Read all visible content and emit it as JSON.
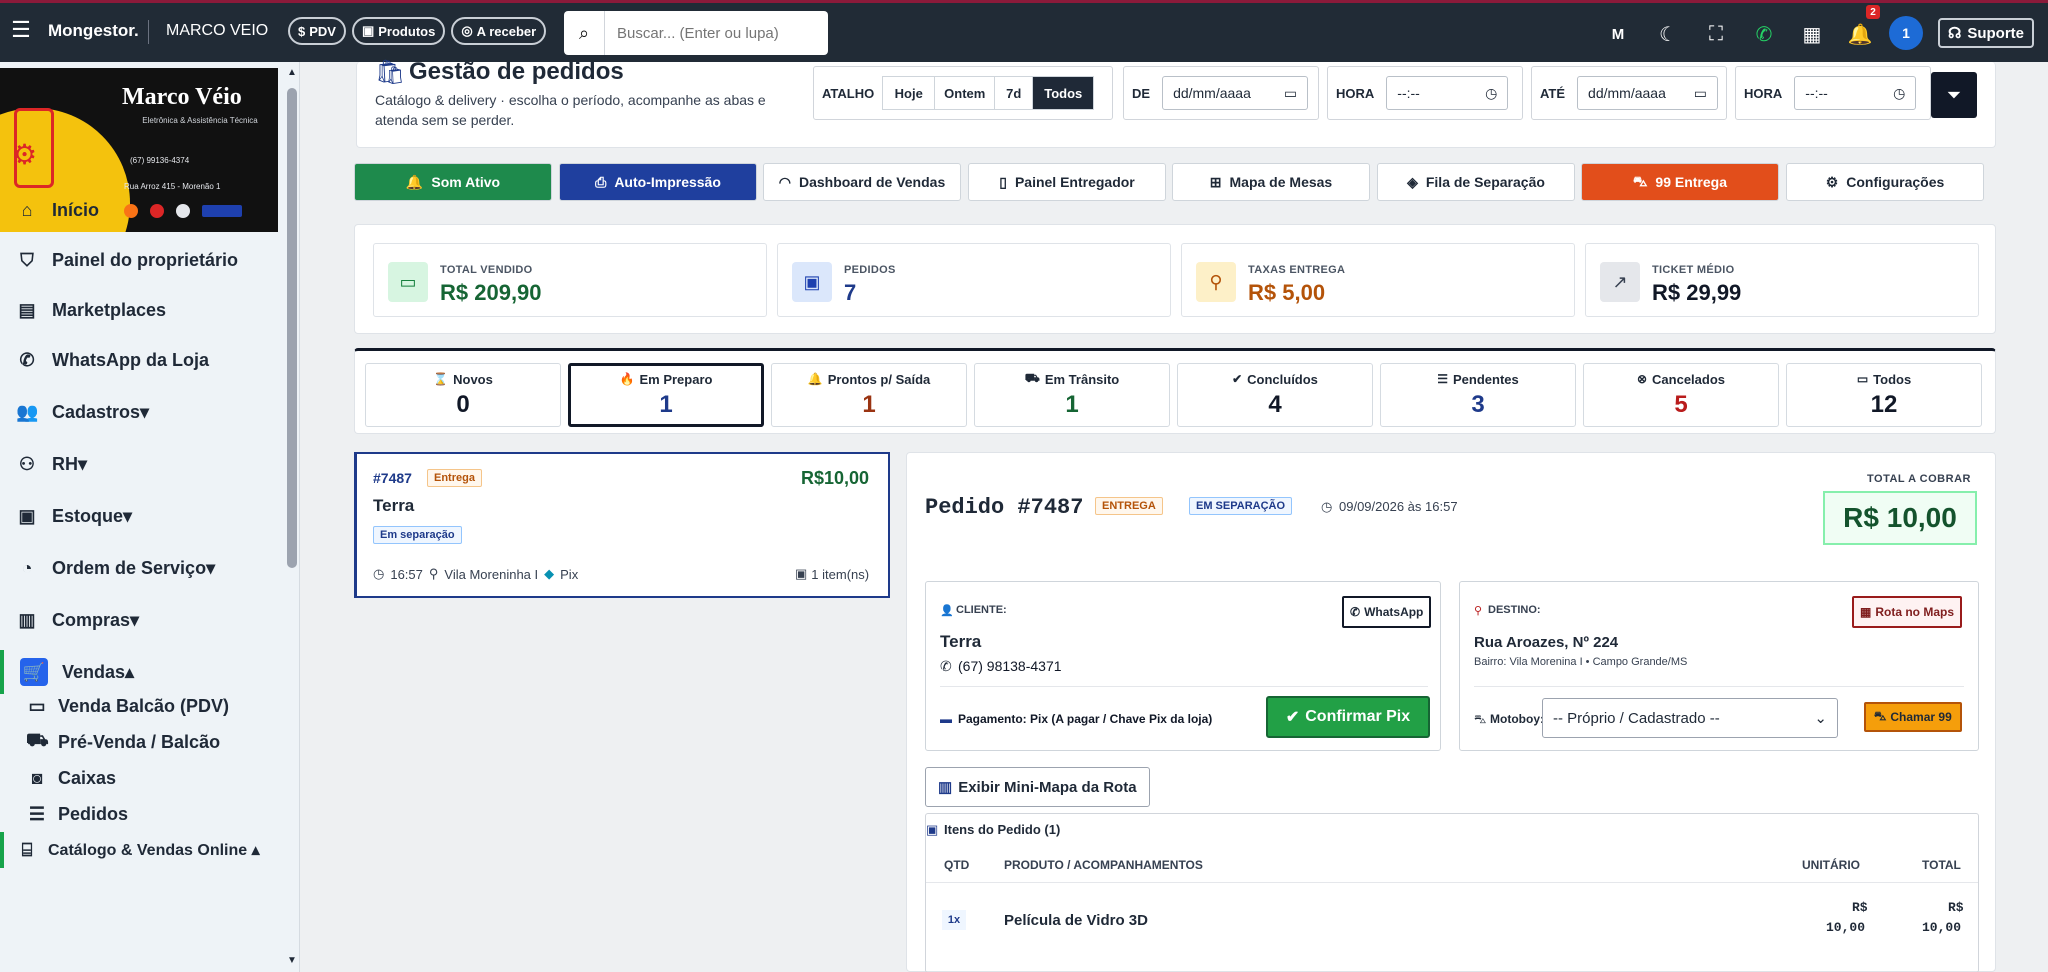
{
  "topbar": {
    "brand": "Mongestor.",
    "store": "MARCO VEIO",
    "pills": [
      {
        "icon": "dollar-icon",
        "label": "PDV"
      },
      {
        "icon": "box-icon",
        "label": "Produtos"
      },
      {
        "icon": "money-icon",
        "label": "A receber"
      }
    ],
    "search_placeholder": "Buscar... (Enter ou lupa)",
    "notif_count": "2",
    "avatar": "1",
    "support": "Suporte"
  },
  "logo": {
    "name": "Marco Véio",
    "subtitle": "Eletrônica & Assistência Técnica",
    "phone": "(67) 99136-4374",
    "address": "Rua Arroz 415 - Morenão 1"
  },
  "sidebar": {
    "items": [
      {
        "icon": "home-icon",
        "glyph": "⌂",
        "label": "Início"
      },
      {
        "icon": "shield-icon",
        "glyph": "⛉",
        "label": "Painel do proprietário"
      },
      {
        "icon": "store-icon",
        "glyph": "▤",
        "label": "Marketplaces"
      },
      {
        "icon": "whatsapp-icon",
        "glyph": "✆",
        "label": "WhatsApp da Loja"
      },
      {
        "icon": "users-icon",
        "glyph": "👥",
        "label": "Cadastros▾"
      },
      {
        "icon": "people-icon",
        "glyph": "⚇",
        "label": "RH▾"
      },
      {
        "icon": "box-icon",
        "glyph": "▣",
        "label": "Estoque▾"
      },
      {
        "icon": "gauge-icon",
        "glyph": "◔",
        "label": "Ordem de Serviço▾"
      },
      {
        "icon": "bag-icon",
        "glyph": "▥",
        "label": "Compras▾"
      },
      {
        "icon": "cart-icon",
        "glyph": "🛒",
        "label": "Vendas▴"
      }
    ],
    "subitems": [
      {
        "icon": "register-icon",
        "glyph": "▭",
        "label": "Venda Balcão (PDV)"
      },
      {
        "icon": "cart-small-icon",
        "glyph": "⛟",
        "label": "Pré-Venda / Balcão"
      },
      {
        "icon": "cash-icon",
        "glyph": "◙",
        "label": "Caixas"
      },
      {
        "icon": "list-icon",
        "glyph": "☰",
        "label": "Pedidos"
      },
      {
        "icon": "shop-icon",
        "glyph": "⌸",
        "label": "Catálogo & Vendas Online ▴"
      }
    ]
  },
  "header": {
    "title": "Gestão de pedidos",
    "subtitle": "Catálogo & delivery · escolha o período, acompanhe as abas e atenda sem se perder.",
    "atalho_label": "ATALHO",
    "atalhos": [
      "Hoje",
      "Ontem",
      "7d",
      "Todos"
    ],
    "de_label": "DE",
    "ate_label": "ATÉ",
    "hora_label": "HORA",
    "date_placeholder": "dd/mm/aaaa",
    "time_placeholder": "--:--"
  },
  "quick_buttons": [
    {
      "label": "Som Ativo",
      "icon": "bell-icon",
      "glyph": "🔔",
      "bg": "#1e8a4c",
      "fg": "#ffffff"
    },
    {
      "label": "Auto-Impressão",
      "icon": "printer-icon",
      "glyph": "⎙",
      "bg": "#1f3f9e",
      "fg": "#ffffff"
    },
    {
      "label": "Dashboard de Vendas",
      "icon": "dashboard-icon",
      "glyph": "◠",
      "bg": "#ffffff",
      "fg": "#1f2937"
    },
    {
      "label": "Painel Entregador",
      "icon": "phone-icon",
      "glyph": "▯",
      "bg": "#ffffff",
      "fg": "#1f2937"
    },
    {
      "label": "Mapa de Mesas",
      "icon": "grid-icon",
      "glyph": "⊞",
      "bg": "#ffffff",
      "fg": "#1f2937"
    },
    {
      "label": "Fila de Separação",
      "icon": "box-icon",
      "glyph": "◈",
      "bg": "#ffffff",
      "fg": "#1f2937"
    },
    {
      "label": "99 Entrega",
      "icon": "scooter-icon",
      "glyph": "⛍",
      "bg": "#e24e1b",
      "fg": "#ffffff"
    },
    {
      "label": "Configurações",
      "icon": "gear-icon",
      "glyph": "⚙",
      "bg": "#ffffff",
      "fg": "#1f2937"
    }
  ],
  "kpis": [
    {
      "label": "TOTAL VENDIDO",
      "value": "R$ 209,90",
      "icon": "cash-icon",
      "glyph": "▭",
      "ic_bg": "#d7f5e1",
      "ic_fg": "#15803d",
      "val_color": "#166534"
    },
    {
      "label": "PEDIDOS",
      "value": "7",
      "icon": "bag-icon",
      "glyph": "▣",
      "ic_bg": "#dbe7fb",
      "ic_fg": "#1e40af",
      "val_color": "#1e3a8a"
    },
    {
      "label": "TAXAS ENTREGA",
      "value": "R$ 5,00",
      "icon": "bike-icon",
      "glyph": "⚲",
      "ic_bg": "#fdf0c8",
      "ic_fg": "#b45309",
      "val_color": "#b45309"
    },
    {
      "label": "TICKET MÉDIO",
      "value": "R$ 29,99",
      "icon": "chart-icon",
      "glyph": "↗",
      "ic_bg": "#e5e7eb",
      "ic_fg": "#374151",
      "val_color": "#111827"
    }
  ],
  "status_tabs": [
    {
      "label": "Novos",
      "glyph": "⌛",
      "icon": "hourglass-icon",
      "count": "0",
      "color": "#111827"
    },
    {
      "label": "Em Preparo",
      "glyph": "🔥",
      "icon": "flame-icon",
      "count": "1",
      "color": "#1e3a8a"
    },
    {
      "label": "Prontos p/ Saída",
      "glyph": "🔔",
      "icon": "bell-icon",
      "count": "1",
      "color": "#9a3412"
    },
    {
      "label": "Em Trânsito",
      "glyph": "⛟",
      "icon": "truck-icon",
      "count": "1",
      "color": "#166534"
    },
    {
      "label": "Concluídos",
      "glyph": "✔",
      "icon": "check-circle-icon",
      "count": "4",
      "color": "#111827"
    },
    {
      "label": "Pendentes",
      "glyph": "☰",
      "icon": "list-icon",
      "count": "3",
      "color": "#1e3a8a"
    },
    {
      "label": "Cancelados",
      "glyph": "⊗",
      "icon": "cancel-icon",
      "count": "5",
      "color": "#b91c1c"
    },
    {
      "label": "Todos",
      "glyph": "▭",
      "icon": "folder-icon",
      "count": "12",
      "color": "#111827"
    }
  ],
  "order_card": {
    "id": "#7487",
    "badge": "Entrega",
    "price": "R$10,00",
    "customer": "Terra",
    "status": "Em separação",
    "time": "16:57",
    "neighborhood": "Vila Moreninha I",
    "payment": "Pix",
    "items": "1 item(ns)"
  },
  "detail": {
    "title": "Pedido #7487",
    "badge_delivery": "ENTREGA",
    "badge_status": "EM SEPARAÇÃO",
    "datetime": "09/09/2026 às 16:57",
    "total_label": "TOTAL A COBRAR",
    "total": "R$ 10,00",
    "client_label": "CLIENTE:",
    "client_name": "Terra",
    "client_phone": "(67) 98138-4371",
    "whatsapp_btn": "WhatsApp",
    "payment_text": "Pagamento: Pix (A pagar / Chave Pix da loja)",
    "confirm_btn": "Confirmar Pix",
    "dest_label": "DESTINO:",
    "maps_btn": "Rota no Maps",
    "address": "Rua Aroazes, Nº 224",
    "district": "Bairro: Vila Morenina I • Campo Grande/MS",
    "motoboy_label": "Motoboy:",
    "motoboy_value": "-- Próprio / Cadastrado --",
    "call99_btn": "Chamar 99",
    "minimap_btn": "Exibir Mini-Mapa da Rota",
    "items_title": "Itens do Pedido (1)",
    "columns": [
      "QTD",
      "PRODUTO / ACOMPANHAMENTOS",
      "UNITÁRIO",
      "TOTAL"
    ],
    "rows": [
      {
        "qty": "1x",
        "product": "Película de Vidro 3D",
        "unit_cur": "R$",
        "unit": "10,00",
        "total_cur": "R$",
        "total": "10,00"
      }
    ]
  }
}
